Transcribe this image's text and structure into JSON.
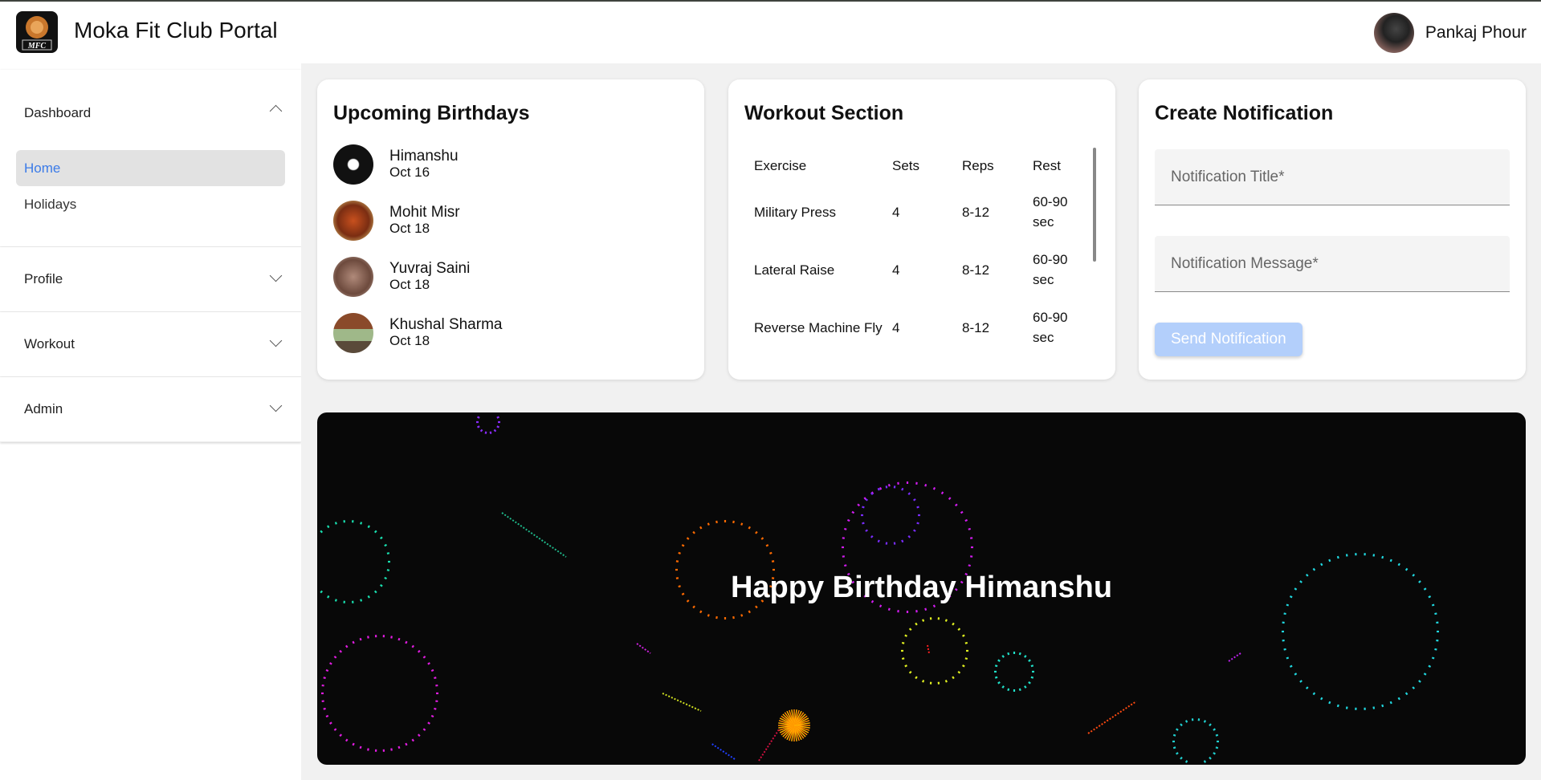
{
  "header": {
    "title": "Moka Fit Club Portal",
    "logo_text": "MFC",
    "user_name": "Pankaj Phour"
  },
  "sidebar": {
    "dashboard": {
      "label": "Dashboard",
      "items": [
        {
          "label": "Home"
        },
        {
          "label": "Holidays"
        }
      ]
    },
    "profile": {
      "label": "Profile"
    },
    "workout": {
      "label": "Workout"
    },
    "admin": {
      "label": "Admin"
    }
  },
  "birthdays": {
    "title": "Upcoming Birthdays",
    "items": [
      {
        "name": "Himanshu",
        "date": "Oct 16"
      },
      {
        "name": "Mohit Misr",
        "date": "Oct 18"
      },
      {
        "name": "Yuvraj Saini",
        "date": "Oct 18"
      },
      {
        "name": "Khushal Sharma",
        "date": "Oct 18"
      }
    ]
  },
  "workout": {
    "title": "Workout Section",
    "headers": [
      "Exercise",
      "Sets",
      "Reps",
      "Rest"
    ],
    "rows": [
      [
        "Military Press",
        "4",
        "8-12",
        "60-90 sec"
      ],
      [
        "Lateral Raise",
        "4",
        "8-12",
        "60-90 sec"
      ],
      [
        "Reverse Machine Fly",
        "4",
        "8-12",
        "60-90 sec"
      ]
    ]
  },
  "notification": {
    "title": "Create Notification",
    "title_placeholder": "Notification Title*",
    "message_placeholder": "Notification Message*",
    "send_label": "Send Notification"
  },
  "banner": {
    "text": "Happy Birthday Himanshu"
  }
}
